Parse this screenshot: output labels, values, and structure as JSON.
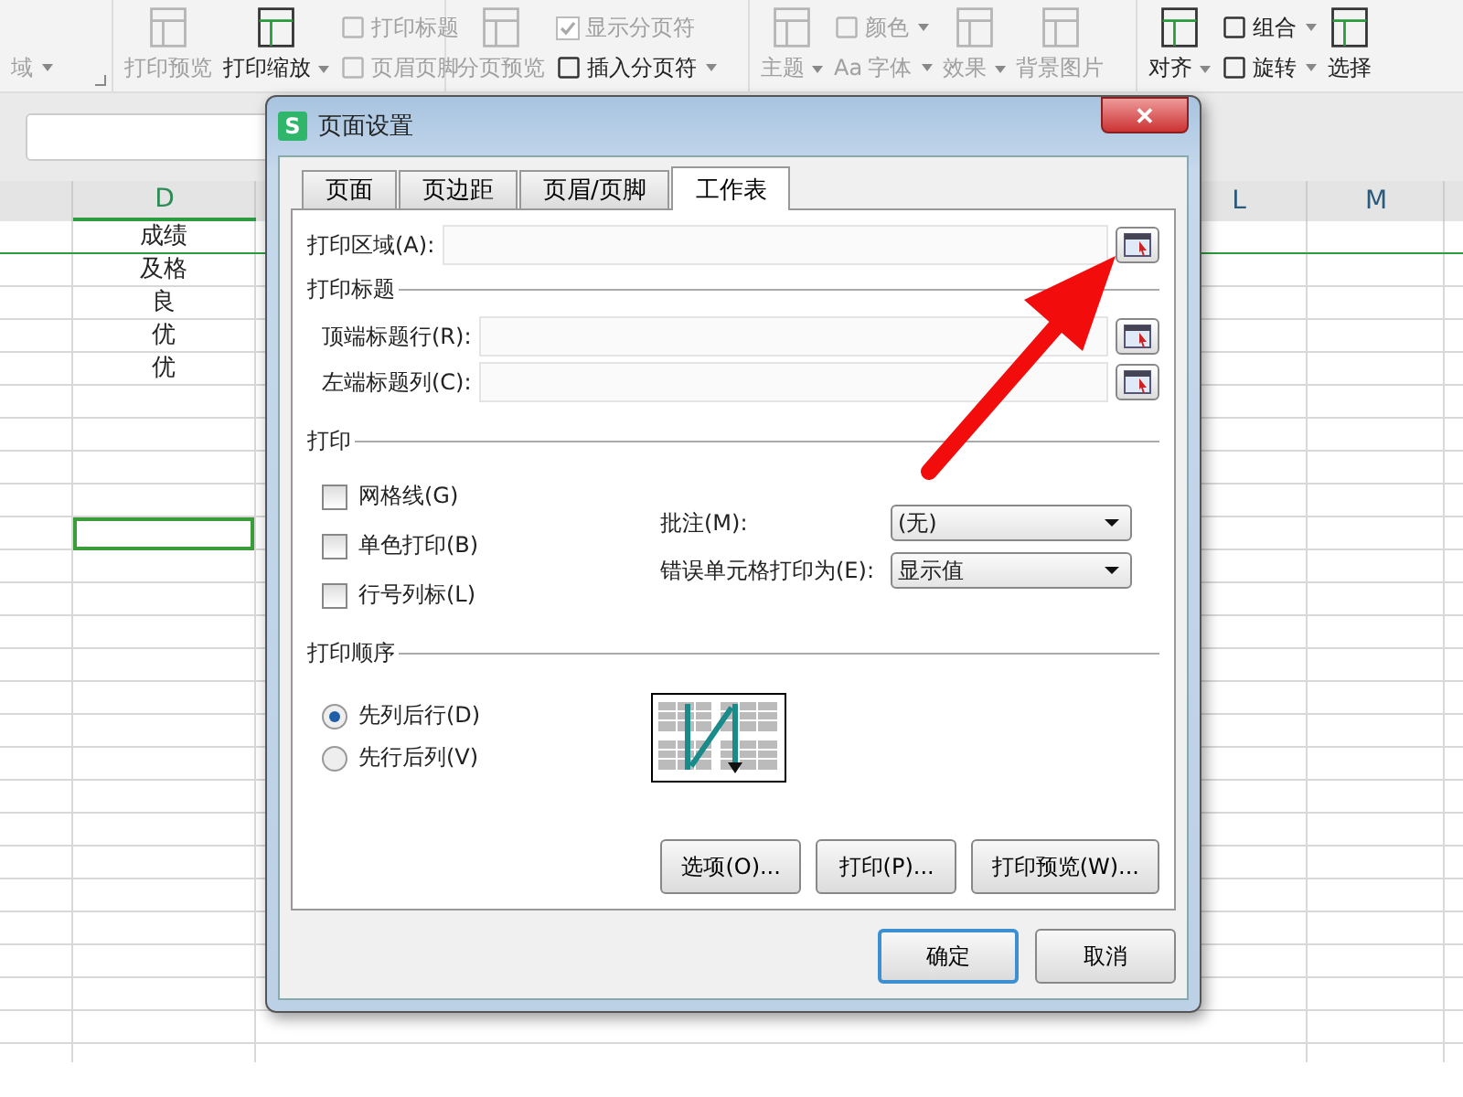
{
  "ribbon": {
    "groups": [
      {
        "launcher": true,
        "columns": [
          [
            {
              "kind": "label",
              "label": "域",
              "dropdown": true,
              "disabled": true
            }
          ]
        ]
      },
      {
        "columns": [
          [
            {
              "kind": "big",
              "label": "打印预览",
              "dropdown": false,
              "disabled": true
            }
          ],
          [
            {
              "kind": "big",
              "label": "打印缩放",
              "dropdown": true,
              "disabled": false
            }
          ],
          [
            {
              "kind": "small",
              "label": "打印标题",
              "dropdown": false,
              "disabled": true
            },
            {
              "kind": "small",
              "label": "页眉页脚",
              "dropdown": false,
              "disabled": true
            }
          ]
        ]
      },
      {
        "columns": [
          [
            {
              "kind": "big",
              "label": "分页预览",
              "dropdown": false,
              "disabled": true
            }
          ],
          [
            {
              "kind": "check",
              "label": "显示分页符",
              "checked": true,
              "disabled": true
            },
            {
              "kind": "small",
              "label": "插入分页符",
              "dropdown": true,
              "disabled": false
            }
          ]
        ]
      },
      {
        "columns": [
          [
            {
              "kind": "big",
              "label": "主题",
              "dropdown": true,
              "disabled": true
            }
          ],
          [
            {
              "kind": "small",
              "label": "颜色",
              "dropdown": true,
              "disabled": true
            },
            {
              "kind": "small",
              "glyph": "Aa",
              "label": "字体",
              "dropdown": true,
              "disabled": true
            }
          ],
          [
            {
              "kind": "big",
              "label": "效果",
              "dropdown": true,
              "disabled": true
            }
          ],
          [
            {
              "kind": "big",
              "label": "背景图片",
              "dropdown": false,
              "disabled": true
            }
          ]
        ]
      },
      {
        "columns": [
          [
            {
              "kind": "big",
              "label": "对齐",
              "dropdown": true,
              "disabled": false
            }
          ],
          [
            {
              "kind": "small",
              "label": "组合",
              "dropdown": true,
              "disabled": false
            },
            {
              "kind": "small",
              "label": "旋转",
              "dropdown": true,
              "disabled": false
            }
          ],
          [
            {
              "kind": "big",
              "label": "选择",
              "dropdown": false,
              "disabled": false
            }
          ]
        ]
      }
    ]
  },
  "sheet": {
    "columns": [
      {
        "label": "D"
      },
      {
        "label": "L"
      },
      {
        "label": "M"
      }
    ],
    "rows": [
      {
        "value": "成绩",
        "selected": false
      },
      {
        "value": "及格",
        "selected": false
      },
      {
        "value": "良",
        "selected": false
      },
      {
        "value": "优",
        "selected": false
      },
      {
        "value": "优",
        "selected": false
      },
      {
        "selected": false
      },
      {
        "selected": false
      },
      {
        "selected": false
      },
      {
        "selected": false
      },
      {
        "selected": true
      }
    ]
  },
  "dialog": {
    "title": "页面设置",
    "app_icon": "S",
    "close": "✕",
    "tabs": [
      {
        "label": "页面",
        "selected": false
      },
      {
        "label": "页边距",
        "selected": false
      },
      {
        "label": "页眉/页脚",
        "selected": false
      },
      {
        "label": "工作表",
        "selected": true
      }
    ],
    "print_area": {
      "label": "打印区域(A):"
    },
    "print_titles": {
      "heading": "打印标题",
      "fields": [
        {
          "label": "顶端标题行(R):"
        },
        {
          "label": "左端标题列(C):"
        }
      ]
    },
    "print": {
      "heading": "打印",
      "checkboxes": [
        {
          "label": "网格线(G)",
          "checked": false
        },
        {
          "label": "单色打印(B)",
          "checked": false
        },
        {
          "label": "行号列标(L)",
          "checked": false
        }
      ],
      "dropdowns": [
        {
          "label": "批注(M):",
          "value": "(无)"
        },
        {
          "label": "错误单元格打印为(E):",
          "value": "显示值"
        }
      ]
    },
    "print_order": {
      "heading": "打印顺序",
      "options": [
        {
          "label": "先列后行(D)",
          "selected": true
        },
        {
          "label": "先行后列(V)",
          "selected": false
        }
      ]
    },
    "buttons": [
      {
        "label": "选项(O)..."
      },
      {
        "label": "打印(P)..."
      },
      {
        "label": "打印预览(W)..."
      }
    ],
    "footer_buttons": [
      {
        "label": "确定",
        "default": true
      },
      {
        "label": "取消",
        "default": false
      }
    ]
  }
}
